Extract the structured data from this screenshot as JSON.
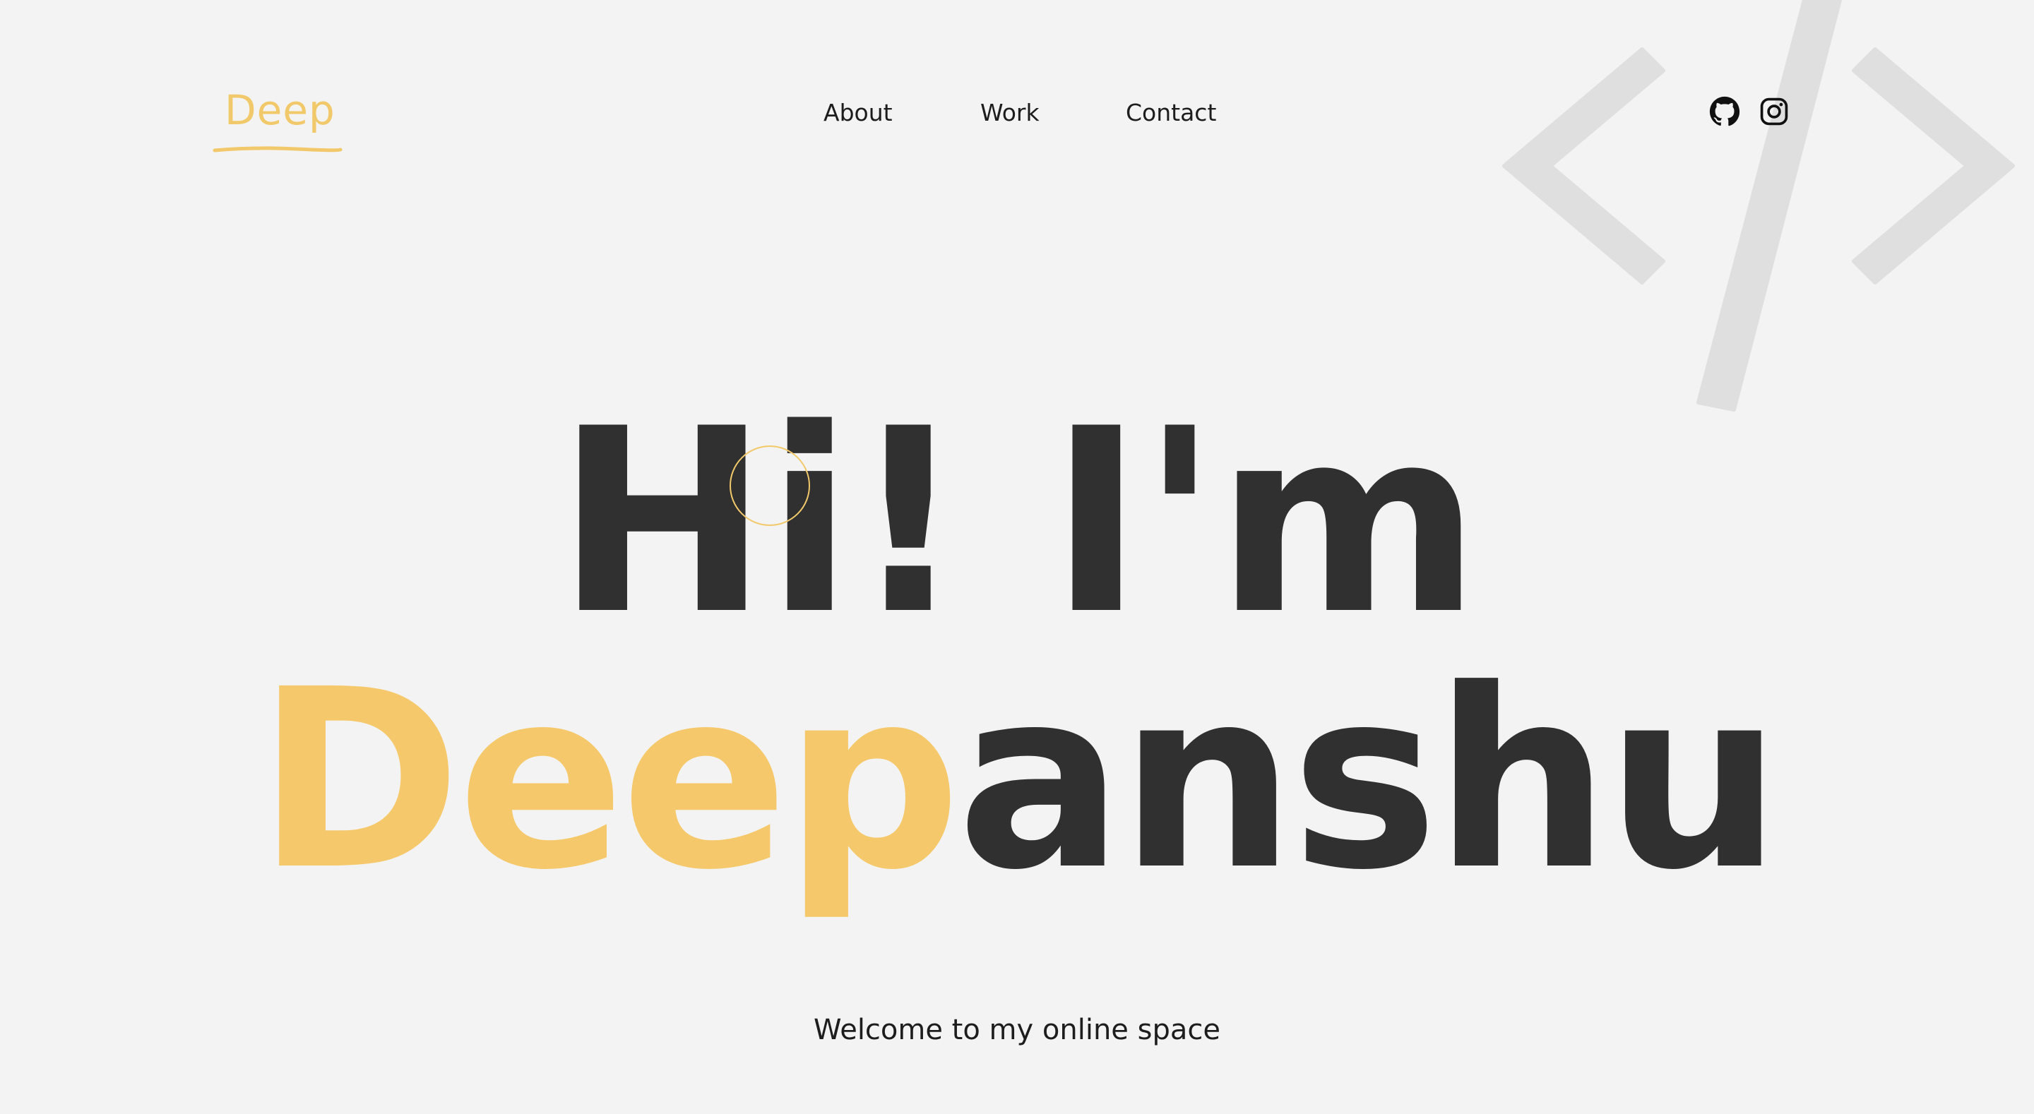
{
  "header": {
    "logo_text": "Deep",
    "nav": [
      {
        "label": "About"
      },
      {
        "label": "Work"
      },
      {
        "label": "Contact"
      }
    ],
    "social": [
      {
        "icon": "github-icon"
      },
      {
        "icon": "instagram-icon"
      }
    ]
  },
  "hero": {
    "greeting": "Hi! I'm",
    "name_highlight": "Deep",
    "name_rest": "anshu",
    "tagline": "Welcome to my online space"
  },
  "colors": {
    "accent": "#f5c96b",
    "text_dark": "#313030",
    "background": "#f3f3f3",
    "decoration": "#dcdcdc"
  }
}
